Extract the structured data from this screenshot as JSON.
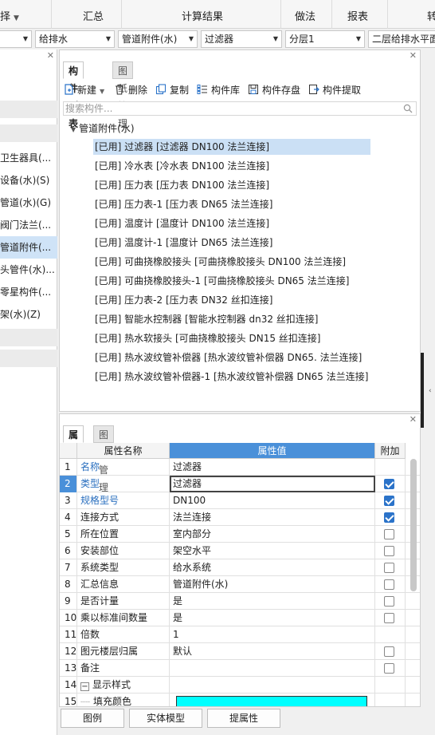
{
  "ribbon": {
    "items": [
      "择",
      "汇总",
      "计算结果",
      "做法",
      "报表",
      "转"
    ]
  },
  "filters": {
    "dd0": "",
    "dd1": "给排水",
    "dd2": "管道附件(水)",
    "dd3": "过滤器",
    "dd4": "分层1",
    "dd5": "二层给排水平面"
  },
  "left_panel": {
    "items": [
      {
        "label": "卫生器具(..."
      },
      {
        "label": "设备(水)(S)"
      },
      {
        "label": "管道(水)(G)"
      },
      {
        "label": "阀门法兰(..."
      },
      {
        "label": "管道附件(..."
      },
      {
        "label": "头管件(水)..."
      },
      {
        "label": "零星构件(..."
      },
      {
        "label": "架(水)(Z)"
      }
    ]
  },
  "component_list": {
    "tabs": [
      "构件列表",
      "图纸管理"
    ],
    "toolbar": {
      "new": "新建",
      "delete": "删除",
      "copy": "复制",
      "library": "构件库",
      "save": "构件存盘",
      "extract": "构件提取"
    },
    "search_placeholder": "搜索构件...",
    "tree_root": "管道附件(水)",
    "items": [
      "[已用] 过滤器 [过滤器 DN100 法兰连接]",
      "[已用] 冷水表 [冷水表 DN100 法兰连接]",
      "[已用] 压力表 [压力表 DN100 法兰连接]",
      "[已用] 压力表-1 [压力表 DN65 法兰连接]",
      "[已用] 温度计 [温度计 DN100 法兰连接]",
      "[已用] 温度计-1 [温度计 DN65 法兰连接]",
      "[已用] 可曲挠橡胶接头 [可曲挠橡胶接头 DN100 法兰连接]",
      "[已用] 可曲挠橡胶接头-1 [可曲挠橡胶接头 DN65 法兰连接]",
      "[已用] 压力表-2 [压力表 DN32 丝扣连接]",
      "[已用] 智能水控制器 [智能水控制器 dn32 丝扣连接]",
      "[已用] 热水软接头 [可曲挠橡胶接头 DN15 丝扣连接]",
      "[已用] 热水波纹管补偿器 [热水波纹管补偿器 DN65. 法兰连接]",
      "[已用] 热水波纹管补偿器-1 [热水波纹管补偿器 DN65 法兰连接]"
    ]
  },
  "properties": {
    "tabs": [
      "属性",
      "图层管理"
    ],
    "headers": {
      "name": "属性名称",
      "value": "属性值",
      "add": "附加"
    },
    "rows": [
      {
        "num": "1",
        "name": "名称",
        "value": "过滤器",
        "blue": true,
        "check": null
      },
      {
        "num": "2",
        "name": "类型",
        "value": "过滤器",
        "blue": true,
        "check": true
      },
      {
        "num": "3",
        "name": "规格型号",
        "value": "DN100",
        "blue": true,
        "check": true
      },
      {
        "num": "4",
        "name": "连接方式",
        "value": "法兰连接",
        "blue": false,
        "check": true
      },
      {
        "num": "5",
        "name": "所在位置",
        "value": "室内部分",
        "blue": false,
        "check": false
      },
      {
        "num": "6",
        "name": "安装部位",
        "value": "架空水平",
        "blue": false,
        "check": false
      },
      {
        "num": "7",
        "name": "系统类型",
        "value": "给水系统",
        "blue": false,
        "check": false
      },
      {
        "num": "8",
        "name": "汇总信息",
        "value": "管道附件(水)",
        "blue": false,
        "check": false
      },
      {
        "num": "9",
        "name": "是否计量",
        "value": "是",
        "blue": false,
        "check": false
      },
      {
        "num": "10",
        "name": "乘以标准间数量",
        "value": "是",
        "blue": false,
        "check": false
      },
      {
        "num": "11",
        "name": "倍数",
        "value": "1",
        "blue": false,
        "check": null
      },
      {
        "num": "12",
        "name": "图元楼层归属",
        "value": "默认",
        "blue": false,
        "check": false
      },
      {
        "num": "13",
        "name": "备注",
        "value": "",
        "blue": false,
        "check": false
      },
      {
        "num": "14",
        "name": "显示样式",
        "value": "",
        "blue": false,
        "check": null
      },
      {
        "num": "15",
        "name": "填充颜色",
        "value": "",
        "blue": false,
        "check": null
      }
    ],
    "fill_color": "#00ffff"
  },
  "bottom_buttons": [
    "图例",
    "实体模型",
    "提属性"
  ],
  "colors": {
    "accent": "#2b73c9",
    "selection": "#cbe0f5"
  }
}
